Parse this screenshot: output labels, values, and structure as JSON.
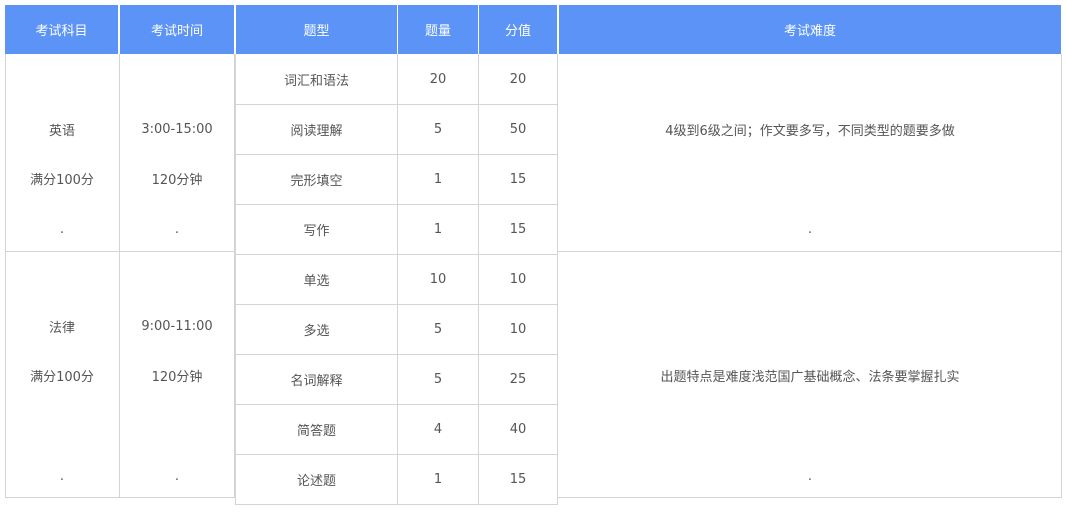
{
  "headers": [
    "考试科目",
    "考试时间",
    "题型",
    "题量",
    "分值",
    "考试难度"
  ],
  "colors": {
    "header_bg": "#5b93f7",
    "header_text": "#ffffff",
    "border": "#d4d4d4",
    "body_text": "#555555"
  },
  "sections": [
    {
      "subject": {
        "name": "英语",
        "score": "满分100分",
        "dot": "."
      },
      "time": {
        "range": "3:00-15:00",
        "duration": "120分钟",
        "dot": "."
      },
      "difficulty": {
        "text": "4级到6级之间；作文要多写，不同类型的题要多做",
        "dot": "."
      },
      "rows": [
        {
          "type": "词汇和语法",
          "count": "20",
          "score": "20"
        },
        {
          "type": "阅读理解",
          "count": "5",
          "score": "50"
        },
        {
          "type": "完形填空",
          "count": "1",
          "score": "15"
        },
        {
          "type": "写作",
          "count": "1",
          "score": "15"
        }
      ]
    },
    {
      "subject": {
        "name": "法律",
        "score": "满分100分",
        "dot": "."
      },
      "time": {
        "range": "9:00-11:00",
        "duration": "120分钟",
        "dot": "."
      },
      "difficulty": {
        "text": "出题特点是难度浅范国广基础概念、法条要掌握扎实",
        "dot": "."
      },
      "rows": [
        {
          "type": "单选",
          "count": "10",
          "score": "10"
        },
        {
          "type": "多选",
          "count": "5",
          "score": "10"
        },
        {
          "type": "名词解释",
          "count": "5",
          "score": "25"
        },
        {
          "type": "简答题",
          "count": "4",
          "score": "40"
        },
        {
          "type": "论述题",
          "count": "1",
          "score": "15"
        }
      ]
    }
  ]
}
